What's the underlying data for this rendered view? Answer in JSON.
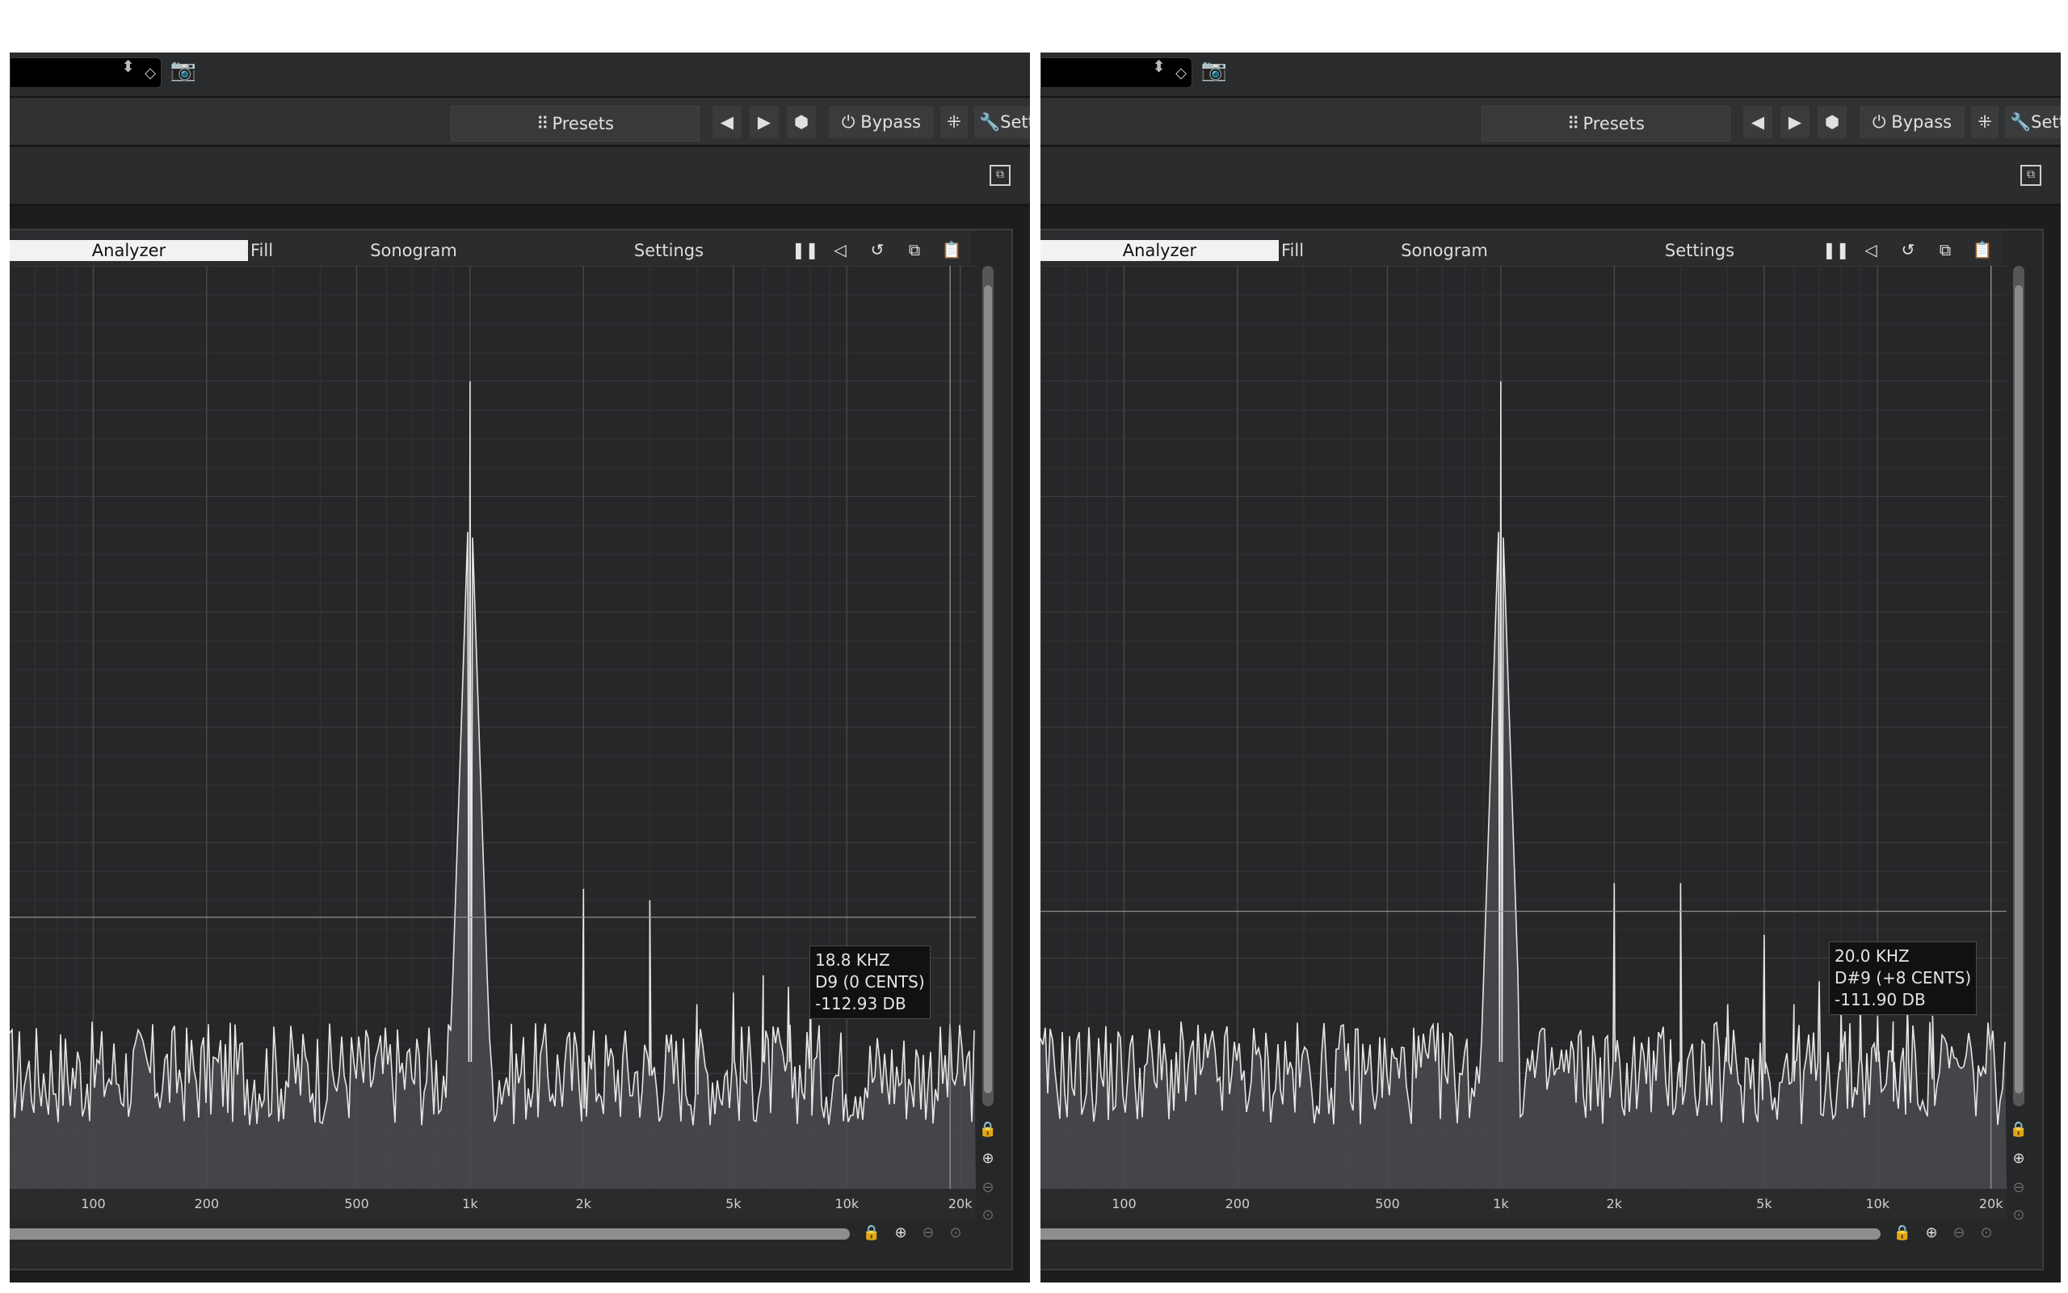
{
  "colors": {
    "background": "#262729",
    "grid": "#3a3b3d",
    "trace": "#e6e6e6",
    "toolbar": "#303133"
  },
  "toolbar": {
    "presets_label": "Presets",
    "bypass_label": "Bypass",
    "settings_label": "Setti",
    "grid_icon": "grid-icon",
    "prev_icon": "chevron-left-icon",
    "next_icon": "chevron-right-icon",
    "random_icon": "dice-icon",
    "bypass_icon": "power-icon",
    "midi_icon": "midi-icon",
    "settings_icon": "wrench-icon",
    "camera_icon": "camera-icon"
  },
  "analyzer": {
    "tabs": [
      "Analyzer",
      "Fill",
      "Sonogram",
      "Settings"
    ],
    "active_tab": "Analyzer",
    "freq_labels": [
      "100",
      "200",
      "500",
      "1k",
      "2k",
      "5k",
      "10k",
      "20k"
    ]
  },
  "panels": [
    {
      "readout": {
        "freq": "18.8 KHZ",
        "note": "D9 (0 CENTS)",
        "level": "-112.93 DB"
      }
    },
    {
      "readout": {
        "freq": "20.0 KHZ",
        "note": "D#9 (+8 CENTS)",
        "level": "-111.90 DB"
      }
    }
  ],
  "chart_data": [
    {
      "type": "line",
      "title": "",
      "xlabel": "",
      "ylabel": "",
      "x_scale": "log",
      "xlim": [
        60,
        22000
      ],
      "ylim": [
        -160,
        0
      ],
      "grid": true,
      "ticks": [
        "100",
        "200",
        "500",
        "1k",
        "2k",
        "5k",
        "10k",
        "20k"
      ],
      "noise_floor_db": -140,
      "cursor": {
        "freq_hz": 18800,
        "db": -112.93
      },
      "peaks": [
        {
          "freq_hz": 1000,
          "db": -20
        },
        {
          "freq_hz": 2000,
          "db": -108
        },
        {
          "freq_hz": 3000,
          "db": -110
        },
        {
          "freq_hz": 4000,
          "db": -128
        },
        {
          "freq_hz": 5000,
          "db": -126
        },
        {
          "freq_hz": 6000,
          "db": -123
        },
        {
          "freq_hz": 7000,
          "db": -125
        },
        {
          "freq_hz": 8000,
          "db": -126
        }
      ]
    },
    {
      "type": "line",
      "title": "",
      "xlabel": "",
      "ylabel": "",
      "x_scale": "log",
      "xlim": [
        60,
        22000
      ],
      "ylim": [
        -160,
        0
      ],
      "grid": true,
      "ticks": [
        "100",
        "200",
        "500",
        "1k",
        "2k",
        "5k",
        "10k",
        "20k"
      ],
      "noise_floor_db": -140,
      "cursor": {
        "freq_hz": 20000,
        "db": -111.9
      },
      "peaks": [
        {
          "freq_hz": 1000,
          "db": -20
        },
        {
          "freq_hz": 2000,
          "db": -107
        },
        {
          "freq_hz": 3000,
          "db": -107
        },
        {
          "freq_hz": 4000,
          "db": -128
        },
        {
          "freq_hz": 5000,
          "db": -116
        },
        {
          "freq_hz": 6000,
          "db": -128
        },
        {
          "freq_hz": 7000,
          "db": -124
        },
        {
          "freq_hz": 8000,
          "db": -129
        },
        {
          "freq_hz": 9000,
          "db": -128
        },
        {
          "freq_hz": 10000,
          "db": -130
        },
        {
          "freq_hz": 11000,
          "db": -131
        },
        {
          "freq_hz": 12000,
          "db": -129
        },
        {
          "freq_hz": 14000,
          "db": -130
        }
      ]
    }
  ]
}
